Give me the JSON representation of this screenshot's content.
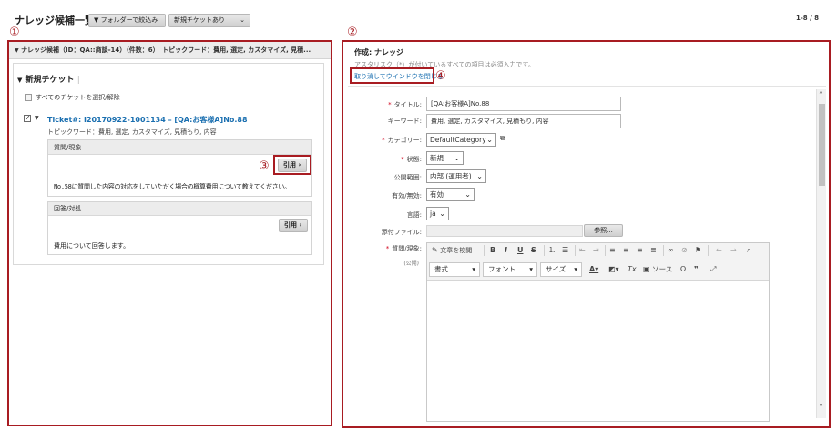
{
  "header": {
    "title": "ナレッジ候補一覧",
    "folder_filter_label": "フォルダーで絞込み",
    "new_ticket_filter_label": "新規チケットあり",
    "page_count": "1-8 / 8"
  },
  "markers": {
    "m1": "①",
    "m2": "②",
    "m3": "③",
    "m4": "④"
  },
  "left": {
    "panel_header": "ナレッジ候補（ID：QA::商談-14）（件数：6）　トピックワード：費用, 選定, カスタマイズ, 見積...",
    "section_title": "新規チケット",
    "select_all_label": "すべてのチケットを選択/解除",
    "ticket": {
      "title": "Ticket#: I20170922-1001134 – [QA:お客様A]No.88",
      "topics": "トピックワード：費用, 選定, カスタマイズ, 見積もり, 内容",
      "question_header": "質問/現象",
      "cite_label": "引用",
      "question_text": "No.58に質問した内容の対応をしていただく場合の概算費用について教えてください。",
      "answer_header": "回答/対処",
      "answer_text": "費用について回答します。"
    }
  },
  "right": {
    "title": "作成: ナレッジ",
    "required_note": "アスタリスク（*）が付いているすべての項目は必須入力です。",
    "cancel_link": "取り消してウインドウを閉じる",
    "form": {
      "title_label": "タイトル:",
      "title_value": "[QA:お客様A]No.88",
      "keyword_label": "キーワード:",
      "keyword_value": "費用, 選定, カスタマイズ, 見積もり, 内容",
      "category_label": "カテゴリー:",
      "category_value": "DefaultCategory",
      "state_label": "状態:",
      "state_value": "新規",
      "scope_label": "公開範囲:",
      "scope_value": "内部 (運用者)",
      "valid_label": "有効/無効:",
      "valid_value": "有効",
      "lang_label": "言語:",
      "lang_value": "ja",
      "attachment_label": "添付ファイル:",
      "browse_label": "参照...",
      "question_label": "質問/現象:",
      "question_sub": "(公開)"
    },
    "editor": {
      "proofread": "文章を校閲",
      "format": "書式",
      "font": "フォント",
      "size": "サイズ",
      "source": "ソース"
    }
  },
  "colors": {
    "annotation": "#a81c22",
    "link": "#1a6fb0",
    "required": "#d0021b"
  }
}
